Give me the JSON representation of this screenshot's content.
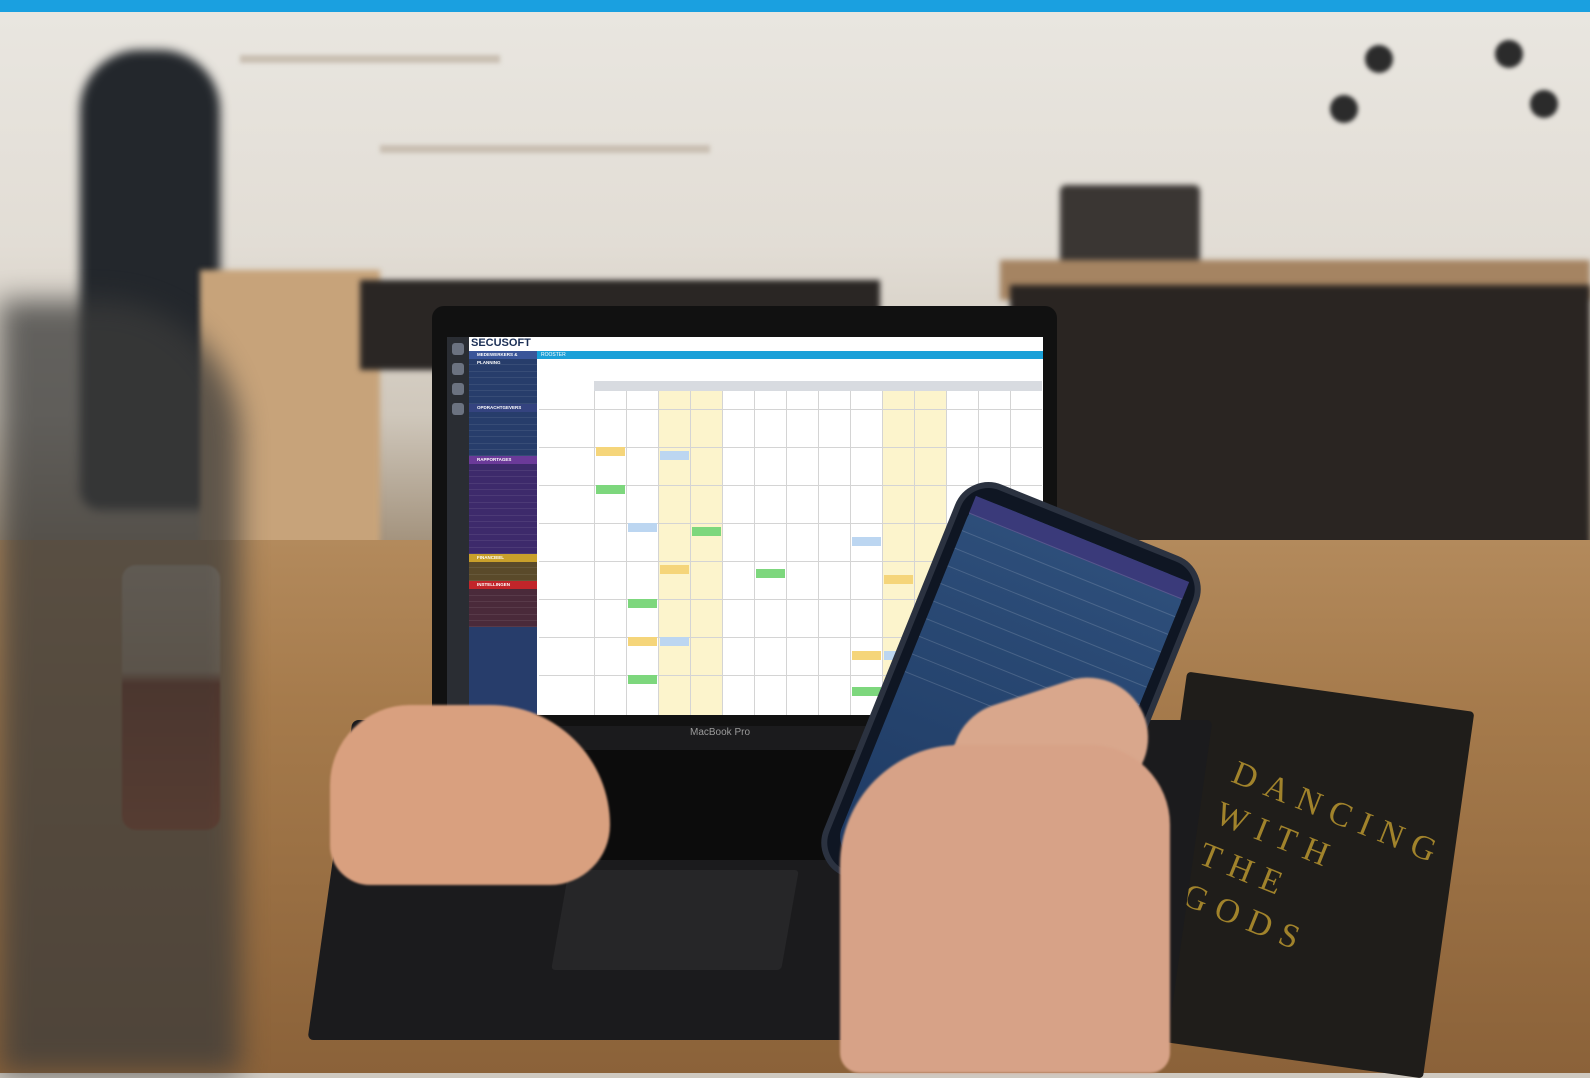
{
  "photo": {
    "description_free": true,
    "colors": {
      "accent_bar": "#1aa0e0",
      "sidebar": "#273d6b",
      "titlebar": "#1aa0d8"
    }
  },
  "laptop": {
    "model_label": "MacBook Pro",
    "app": {
      "logo": "SECUSOFT",
      "tab_title": "ROOSTER",
      "sidebar_sections": [
        {
          "label": "MEDEWERKERS & PLANNING",
          "color": "#3a5599"
        },
        {
          "label": "OPDRACHTGEVERS",
          "color": "#34437f"
        },
        {
          "label": "RAPPORTAGES",
          "color": "#6b3a99"
        },
        {
          "label": "FINANCIEEL",
          "color": "#c9a02b"
        },
        {
          "label": "INSTELLINGEN",
          "color": "#c2252a"
        }
      ]
    }
  },
  "book": {
    "cover_text": "DANCING WITH THE GODS"
  }
}
